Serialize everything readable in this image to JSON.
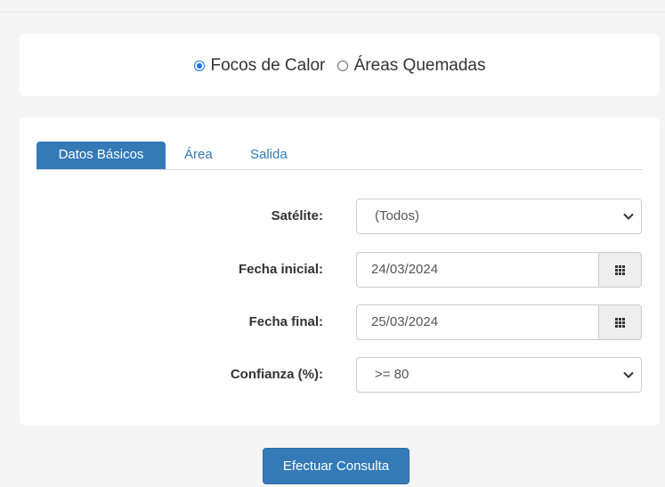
{
  "data_type": {
    "options": [
      {
        "label": "Focos de Calor",
        "checked": true
      },
      {
        "label": "Áreas Quemadas",
        "checked": false
      }
    ]
  },
  "tabs": [
    {
      "label": "Datos Básicos",
      "active": true
    },
    {
      "label": "Área",
      "active": false
    },
    {
      "label": "Salida",
      "active": false
    }
  ],
  "form": {
    "satellite": {
      "label": "Satélite:",
      "value": "(Todos)"
    },
    "start_date": {
      "label": "Fecha inicial:",
      "value": "24/03/2024"
    },
    "end_date": {
      "label": "Fecha final:",
      "value": "25/03/2024"
    },
    "confidence": {
      "label": "Confianza (%):",
      "value": ">= 80"
    }
  },
  "submit": {
    "label": "Efectuar Consulta"
  },
  "icons": {
    "calendar_button": "calendar-grid-icon",
    "select_arrow": "chevron-down-icon"
  },
  "colors": {
    "primary": "#337ab7",
    "radio_accent": "#1a73e8"
  }
}
